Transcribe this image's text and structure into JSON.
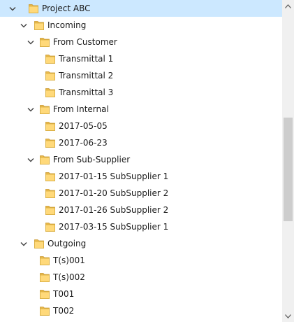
{
  "tree": {
    "rows": [
      {
        "id": "project-abc",
        "label": "Project ABC",
        "expanded": true,
        "selected": true
      },
      {
        "id": "incoming",
        "label": "Incoming",
        "expanded": true
      },
      {
        "id": "from-customer",
        "label": "From Customer",
        "expanded": true
      },
      {
        "id": "transmittal-1",
        "label": "Transmittal 1"
      },
      {
        "id": "transmittal-2",
        "label": "Transmittal 2"
      },
      {
        "id": "transmittal-3",
        "label": "Transmittal 3"
      },
      {
        "id": "from-internal",
        "label": "From Internal",
        "expanded": true
      },
      {
        "id": "2017-05-05",
        "label": "2017-05-05"
      },
      {
        "id": "2017-06-23",
        "label": "2017-06-23"
      },
      {
        "id": "from-sub-supplier",
        "label": "From Sub-Supplier",
        "expanded": true
      },
      {
        "id": "2017-01-15-subsupplier-1",
        "label": "2017-01-15 SubSupplier 1"
      },
      {
        "id": "2017-01-20-subsupplier-2",
        "label": "2017-01-20 SubSupplier 2"
      },
      {
        "id": "2017-01-26-subsupplier-2",
        "label": "2017-01-26 SubSupplier 2"
      },
      {
        "id": "2017-03-15-subsupplier-1",
        "label": "2017-03-15 SubSupplier 1"
      },
      {
        "id": "outgoing",
        "label": "Outgoing",
        "expanded": true
      },
      {
        "id": "ts001",
        "label": "T(s)001"
      },
      {
        "id": "ts002",
        "label": "T(s)002"
      },
      {
        "id": "t001",
        "label": "T001"
      },
      {
        "id": "t002",
        "label": "T002"
      }
    ]
  },
  "colors": {
    "selection": "#cce8ff",
    "folder_fill": "#ffd97a",
    "folder_tab": "#e8b84a",
    "scrollbar_track": "#f0f0f0",
    "scrollbar_thumb": "#cdcdcd"
  },
  "icons": {
    "expand": "chevron-down-icon",
    "folder": "folder-icon",
    "scroll_up": "arrow-up-icon",
    "scroll_down": "arrow-down-icon"
  }
}
